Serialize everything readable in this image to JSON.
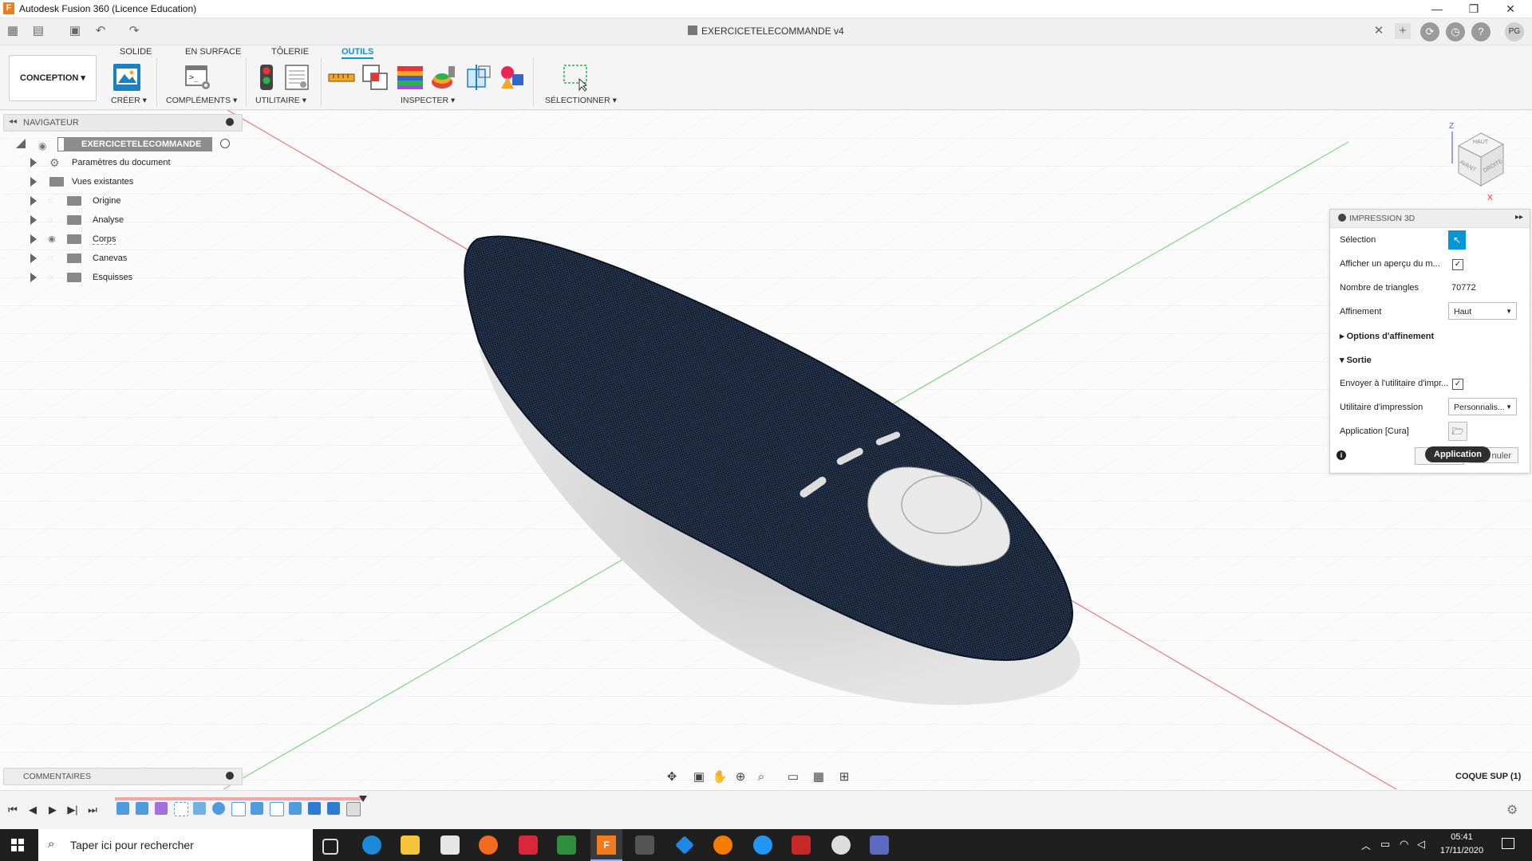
{
  "window": {
    "title": "Autodesk Fusion 360 (Licence Education)",
    "logo_letter": "F",
    "minimize": "—",
    "maximize": "❐",
    "close": "✕"
  },
  "qa": {
    "doc_tab": "EXERCICETELECOMMANDE v4",
    "doc_close": "✕",
    "user_initials": "PG"
  },
  "ribbon": {
    "tabs": [
      "SOLIDE",
      "EN SURFACE",
      "TÔLERIE",
      "OUTILS"
    ],
    "workspace": "CONCEPTION ▾",
    "groups": [
      "CRÉER ▾",
      "COMPLÉMENTS ▾",
      "UTILITAIRE ▾",
      "INSPECTER ▾",
      "SÉLECTIONNER ▾"
    ]
  },
  "navigator": {
    "title": "NAVIGATEUR",
    "root": "EXERCICETELECOMMANDE v4",
    "items": [
      "Paramètres du document",
      "Vues existantes",
      "Origine",
      "Analyse",
      "Corps",
      "Canevas",
      "Esquisses"
    ]
  },
  "viewcube": {
    "top": "HAUT",
    "front": "AVANT",
    "right": "DROITE",
    "axis_z": "Z",
    "axis_x": "X"
  },
  "panel": {
    "title": "IMPRESSION 3D",
    "selection_label": "Sélection",
    "preview_label": "Afficher un aperçu du m...",
    "triangles_label": "Nombre de triangles",
    "triangles_value": "70772",
    "refine_label": "Affinement",
    "refine_value": "Haut",
    "refine_options": "Options d'affinement",
    "output_section": "Sortie",
    "send_label": "Envoyer à l'utilitaire d'impr...",
    "utility_label": "Utilitaire d'impression",
    "utility_value": "Personnalis...",
    "app_label": "Application [Cura]",
    "cancel_partial": "nuler",
    "tooltip": "Application"
  },
  "comments": {
    "title": "COMMENTAIRES"
  },
  "status": {
    "body_name": "COQUE SUP (1)"
  },
  "taskbar": {
    "search_placeholder": "Taper ici pour rechercher",
    "time": "05:41",
    "date": "17/11/2020"
  },
  "colors": {
    "accent": "#0696d7",
    "model": "#0e1a2e",
    "x_axis": "#e66060",
    "y_axis": "#6ccf6c"
  }
}
